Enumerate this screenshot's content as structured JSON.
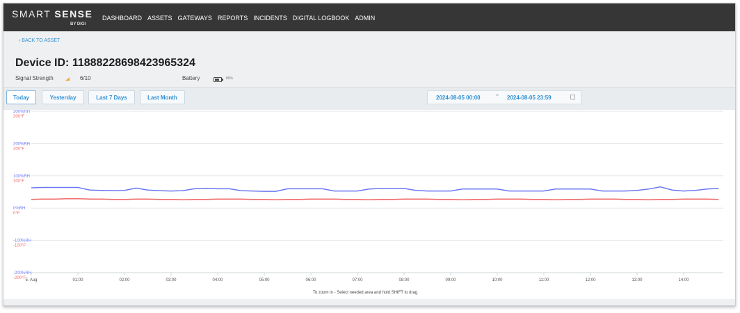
{
  "brand": {
    "name_light": "SMART",
    "name_bold": "SENSE",
    "sub": "BY DIGI"
  },
  "nav": [
    "DASHBOARD",
    "ASSETS",
    "GATEWAYS",
    "REPORTS",
    "INCIDENTS",
    "DIGITAL LOGBOOK",
    "ADMIN"
  ],
  "back_link": "BACK TO ASSET",
  "device": {
    "title": "Device ID: 118882286984239653​24",
    "signal_label": "Signal Strength",
    "signal_value": "6/10",
    "battery_label": "Battery",
    "battery_value": "80%",
    "battery_level": 0.8
  },
  "ranges": {
    "today": "Today",
    "yesterday": "Yesterday",
    "last7": "Last 7 Days",
    "lastmonth": "Last Month"
  },
  "date_range": {
    "start": "2024-08-05 00:00",
    "separator": "^",
    "end": "2024-08-05 23:59"
  },
  "zoom_hint": "To zoom in - Select needed area and hold SHIFT to drag",
  "colors": {
    "humidity": "#6b78f2",
    "temperature": "#f06a6a",
    "accent": "#2d8fd2",
    "topbar": "#363636"
  },
  "chart_data": {
    "type": "line",
    "title": "",
    "x": [
      "00:00",
      "00:15",
      "00:30",
      "00:45",
      "01:00",
      "01:15",
      "01:30",
      "01:45",
      "02:00",
      "02:15",
      "02:30",
      "02:45",
      "03:00",
      "03:15",
      "03:30",
      "03:45",
      "04:00",
      "04:15",
      "04:30",
      "04:45",
      "05:00",
      "05:15",
      "05:30",
      "05:45",
      "06:00",
      "06:15",
      "06:30",
      "06:45",
      "07:00",
      "07:15",
      "07:30",
      "07:45",
      "08:00",
      "08:15",
      "08:30",
      "08:45",
      "09:00",
      "09:15",
      "09:30",
      "09:45",
      "10:00",
      "10:15",
      "10:30",
      "10:45",
      "11:00",
      "11:15",
      "11:30",
      "11:45",
      "12:00",
      "12:15",
      "12:30",
      "12:45",
      "13:00",
      "13:15",
      "13:30",
      "13:45",
      "14:00",
      "14:15",
      "14:30",
      "14:45"
    ],
    "x_tick_labels": [
      "5. Aug",
      "01:00",
      "02:00",
      "03:00",
      "04:00",
      "05:00",
      "06:00",
      "07:00",
      "08:00",
      "09:00",
      "10:00",
      "11:00",
      "12:00",
      "13:00",
      "14:00"
    ],
    "y_axes": [
      {
        "name": "humidity",
        "unit": "%RH",
        "ticks": [
          "300%RH",
          "200%RH",
          "100%RH",
          "0%RH",
          "-100%RH",
          "-200%RH"
        ],
        "range": [
          -200,
          300
        ]
      },
      {
        "name": "temperature",
        "unit": "°F",
        "ticks": [
          "300°F",
          "200°F",
          "100°F",
          "0°F",
          "-100°F",
          "-200°F"
        ],
        "range": [
          -200,
          300
        ]
      }
    ],
    "series": [
      {
        "values": [
          63,
          64,
          64,
          64,
          64,
          56,
          55,
          54,
          55,
          62,
          56,
          54,
          53,
          54,
          60,
          61,
          60,
          60,
          54,
          53,
          52,
          52,
          60,
          60,
          60,
          60,
          53,
          53,
          53,
          59,
          61,
          61,
          61,
          55,
          53,
          53,
          53,
          59,
          59,
          59,
          59,
          53,
          53,
          53,
          53,
          59,
          59,
          59,
          59,
          53,
          53,
          53,
          55,
          59,
          66,
          56,
          53,
          55,
          59,
          61
        ]
      },
      {
        "values": [
          27,
          28,
          28,
          29,
          29,
          28,
          28,
          27,
          27,
          28,
          28,
          27,
          27,
          26,
          27,
          27,
          28,
          28,
          28,
          27,
          27,
          26,
          27,
          27,
          28,
          28,
          28,
          27,
          27,
          26,
          27,
          27,
          28,
          28,
          28,
          27,
          27,
          26,
          27,
          27,
          28,
          28,
          28,
          27,
          27,
          26,
          27,
          27,
          28,
          28,
          28,
          27,
          27,
          26,
          27,
          27,
          28,
          28,
          28,
          27
        ]
      }
    ],
    "grid": true,
    "legend": "none"
  }
}
